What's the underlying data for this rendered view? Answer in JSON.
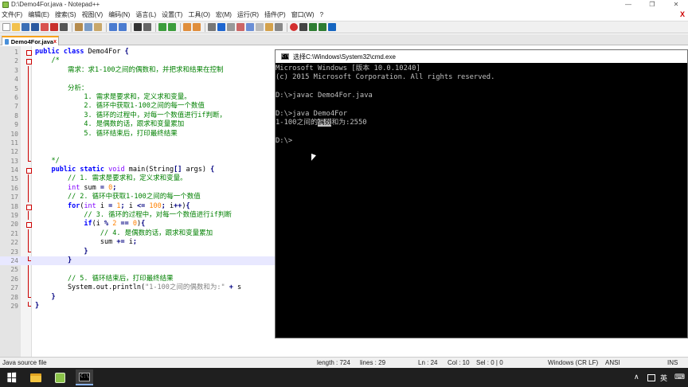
{
  "npp": {
    "title": "D:\\Demo4For.java - Notepad++",
    "window_controls": [
      "—",
      "❐",
      "✕"
    ],
    "menu": [
      "文件(F)",
      "编辑(E)",
      "搜索(S)",
      "视图(V)",
      "编码(N)",
      "语言(L)",
      "设置(T)",
      "工具(O)",
      "宏(M)",
      "运行(R)",
      "插件(P)",
      "窗口(W)",
      "?"
    ],
    "menu_close": "X",
    "tab": {
      "label": "Demo4For.java",
      "close": "x"
    },
    "code_lines": [
      {
        "n": "1",
        "fold": "box",
        "html": "<span class='kw'>public</span> <span class='kw'>class</span> Demo4For <span class='op'>{</span>"
      },
      {
        "n": "2",
        "fold": "box",
        "html": "    <span class='cm'>/*</span>"
      },
      {
        "n": "3",
        "fold": "bar",
        "html": "<span class='cm'>        需求：求1-100之间的偶数和，并把求和结果在控制</span>"
      },
      {
        "n": "4",
        "fold": "bar",
        "html": ""
      },
      {
        "n": "5",
        "fold": "bar",
        "html": "<span class='cm'>        分析：</span>"
      },
      {
        "n": "6",
        "fold": "bar",
        "html": "<span class='cm'>            1. 需求是要求和，定义求和变量。</span>"
      },
      {
        "n": "7",
        "fold": "bar",
        "html": "<span class='cm'>            2. 循环中获取1-100之间的每一个数值</span>"
      },
      {
        "n": "8",
        "fold": "bar",
        "html": "<span class='cm'>            3. 循环的过程中，对每一个数值进行if判断，</span>"
      },
      {
        "n": "9",
        "fold": "bar",
        "html": "<span class='cm'>            4. 是偶数的话，跟求和变量累加</span>"
      },
      {
        "n": "10",
        "fold": "bar",
        "html": "<span class='cm'>            5. 循环结束后，打印最终结果</span>"
      },
      {
        "n": "11",
        "fold": "bar",
        "html": ""
      },
      {
        "n": "12",
        "fold": "bar",
        "html": ""
      },
      {
        "n": "13",
        "fold": "end",
        "html": "<span class='cm'>    */</span>"
      },
      {
        "n": "14",
        "fold": "box",
        "html": "    <span class='kw'>public</span> <span class='kw'>static</span> <span class='ty'>void</span> main(String<span class='op'>[]</span> args) <span class='op'>{</span>"
      },
      {
        "n": "15",
        "fold": "bar",
        "html": "        <span class='cm'>// 1. 需求是要求和，定义求和变量。</span>"
      },
      {
        "n": "16",
        "fold": "bar",
        "html": "        <span class='ty'>int</span> sum <span class='op'>=</span> <span class='num'>0</span><span class='op'>;</span>"
      },
      {
        "n": "17",
        "fold": "bar",
        "html": "        <span class='cm'>// 2. 循环中获取1-100之间的每一个数值</span>"
      },
      {
        "n": "18",
        "fold": "box",
        "html": "        <span class='kw'>for</span>(<span class='ty'>int</span> i <span class='op'>=</span> <span class='num'>1</span><span class='op'>;</span> i <span class='op'>&lt;=</span> <span class='num'>100</span><span class='op'>;</span> i<span class='op'>++</span>)<span class='op'>{</span>"
      },
      {
        "n": "19",
        "fold": "bar",
        "html": "            <span class='cm'>// 3. 循环的过程中，对每一个数值进行if判断</span>"
      },
      {
        "n": "20",
        "fold": "box",
        "html": "            <span class='kw'>if</span>(i <span class='op'>%</span> <span class='num'>2</span> <span class='op'>==</span> <span class='num'>0</span>)<span class='op'>{</span>"
      },
      {
        "n": "21",
        "fold": "bar",
        "html": "                <span class='cm'>// 4. 是偶数的话，跟求和变量累加</span>"
      },
      {
        "n": "22",
        "fold": "bar",
        "html": "                sum <span class='op'>+=</span> i<span class='op'>;</span>"
      },
      {
        "n": "23",
        "fold": "end",
        "html": "            <span class='op'>}</span>"
      },
      {
        "n": "24",
        "fold": "end",
        "html": "        <span class='op'>}</span>",
        "current": true
      },
      {
        "n": "25",
        "fold": "bar",
        "html": ""
      },
      {
        "n": "26",
        "fold": "bar",
        "html": "        <span class='cm'>// 5. 循环结束后，打印最终结果</span>"
      },
      {
        "n": "27",
        "fold": "bar",
        "html": "        System.out.println(<span class='str'>\"1-100之间的偶数和为:\"</span> <span class='op'>+</span> s"
      },
      {
        "n": "28",
        "fold": "end",
        "html": "    <span class='op'>}</span>"
      },
      {
        "n": "29",
        "fold": "end",
        "html": "<span class='op'>}</span>"
      }
    ],
    "status": {
      "file_type": "Java source file",
      "length": "length : 724",
      "lines": "lines : 29",
      "ln": "Ln : 24",
      "col": "Col : 10",
      "sel": "Sel : 0 | 0",
      "eol": "Windows (CR LF)",
      "encoding": "ANSI",
      "mode": "INS"
    }
  },
  "cmd": {
    "title": "选择C:\\Windows\\System32\\cmd.exe",
    "icon_text": "C:\\",
    "lines": [
      "Microsoft Windows [版本 10.0.10240]",
      "(c) 2015 Microsoft Corporation. All rights reserved.",
      "",
      "D:\\>javac Demo4For.java",
      "",
      "D:\\>java Demo4For",
      "",
      "",
      "D:\\>"
    ],
    "output_line": {
      "before": "1-100之间的",
      "selected": "偶数",
      "after": "和为:2550"
    }
  },
  "taskbar": {
    "cmd_icon_text": "C:\\",
    "tray_up": "∧",
    "ime_lang": "英",
    "ime_kbd": "⌨"
  }
}
